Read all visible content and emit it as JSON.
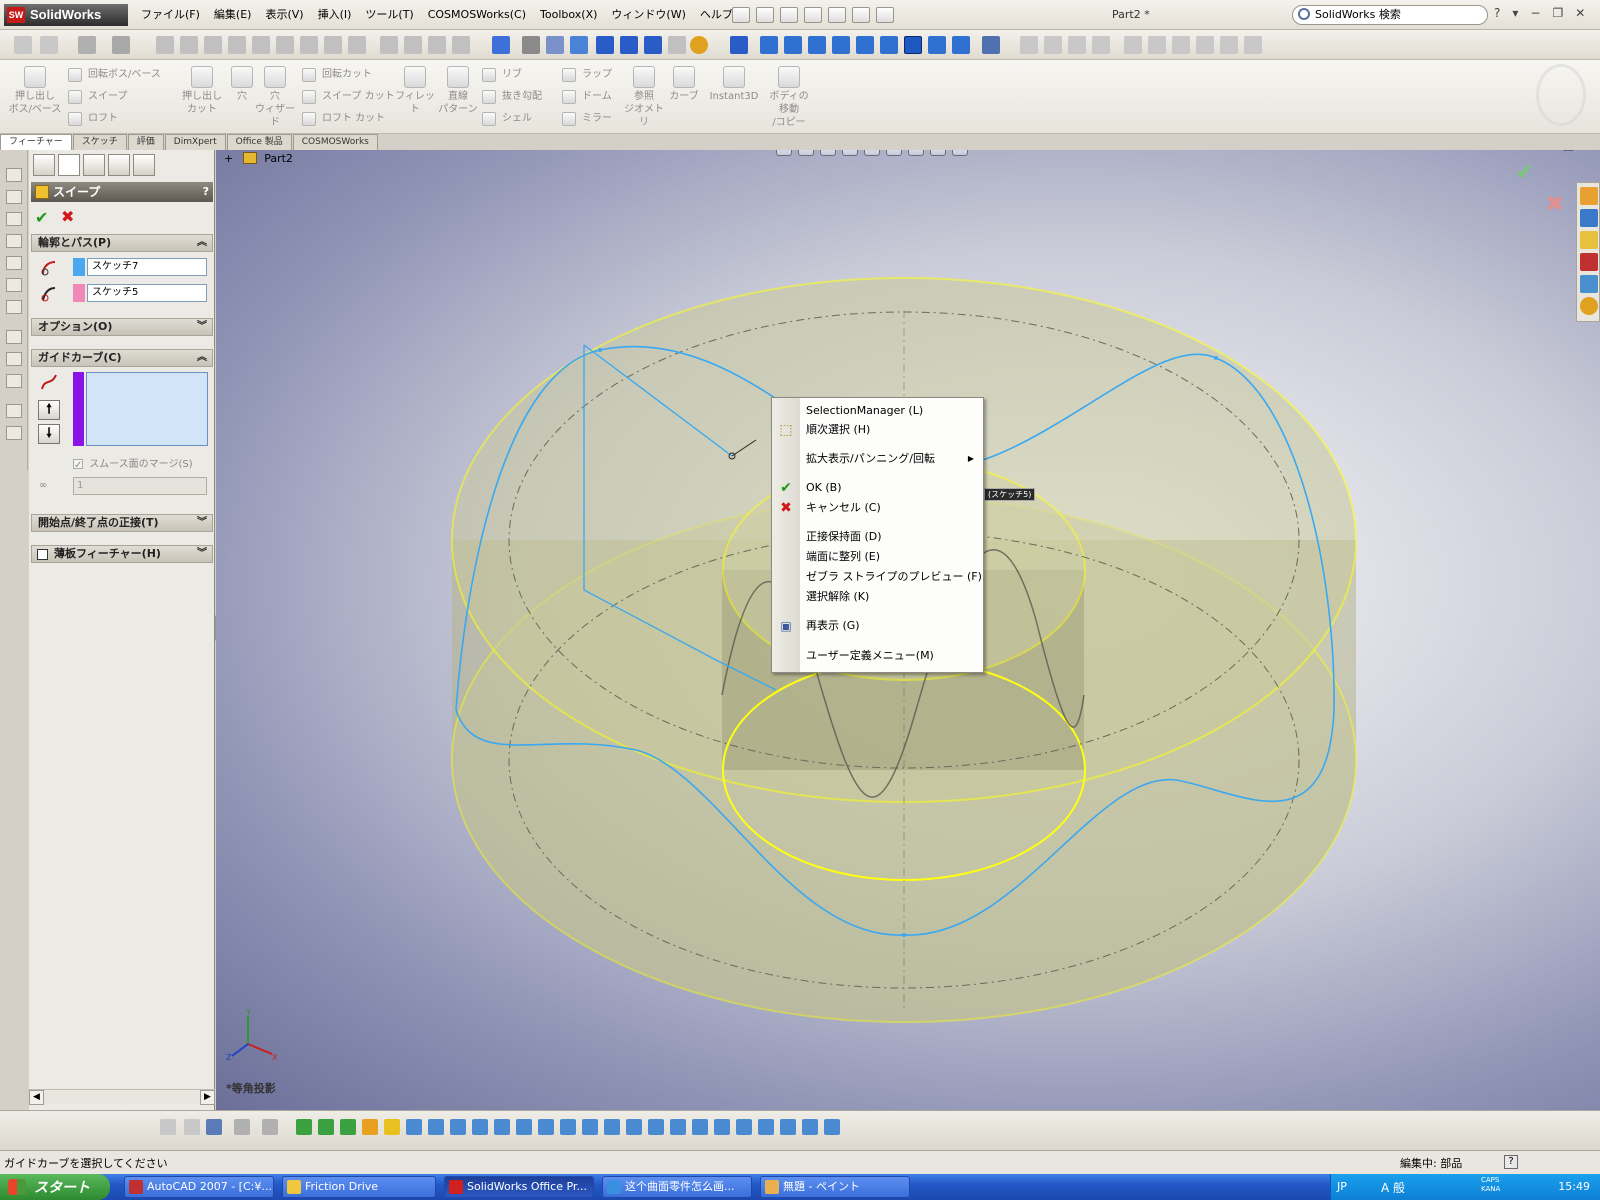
{
  "app": {
    "logo_text": "SolidWorks",
    "document_title": "Part2 *",
    "search_placeholder": "SolidWorks 検索",
    "window_controls": [
      "?",
      "▾",
      "−",
      "❐",
      "✕"
    ]
  },
  "menu": [
    "ファイル(F)",
    "編集(E)",
    "表示(V)",
    "挿入(I)",
    "ツール(T)",
    "COSMOSWorks(C)",
    "Toolbox(X)",
    "ウィンドウ(W)",
    "ヘルプ(H)"
  ],
  "command_manager": {
    "large": [
      {
        "label": "押し出し\nボス/ベース"
      },
      {
        "label": "押し出し\nカット"
      },
      {
        "label": "穴"
      },
      {
        "label": "穴\nウィザード"
      },
      {
        "label": "フィレット"
      },
      {
        "label": "直線\nパターン"
      },
      {
        "label": "参照\nジオメトリ"
      },
      {
        "label": "カーブ"
      },
      {
        "label": "Instant3D"
      },
      {
        "label": "ボディの\n移動\n/コピー"
      }
    ],
    "small": {
      "revolve_boss": "回転ボス/ベース",
      "sweep": "スイープ",
      "loft": "ロフト",
      "revolve_cut": "回転カット",
      "sweep_cut": "スイープ カット",
      "loft_cut": "ロフト カット",
      "rib": "リブ",
      "draft": "抜き勾配",
      "shell": "シェル",
      "wrap": "ラップ",
      "dome": "ドーム",
      "mirror": "ミラー"
    }
  },
  "tabs": [
    "フィーチャー",
    "スケッチ",
    "評価",
    "DimXpert",
    "Office 製品",
    "COSMOSWorks"
  ],
  "property_manager": {
    "title": "スイープ",
    "groups": {
      "profile_path": "輪郭とパス(P)",
      "options": "オプション(O)",
      "guide_curves": "ガイドカーブ(C)",
      "tangency": "開始点/終了点の正接(T)",
      "thin_feature": "薄板フィーチャー(H)"
    },
    "profile_field": "スケッチ7",
    "path_field": "スケッチ5",
    "merge_smooth_label": "スムース面のマージ(S)",
    "spin_value": "1",
    "colors": {
      "profile": "#4aa8f0",
      "path": "#f088b8",
      "guide": "#8a14e8"
    }
  },
  "viewport": {
    "tree_root": "Part2",
    "view_label": "*等角投影",
    "sketch_tag": "(スケッチ5)"
  },
  "context_menu": {
    "items": [
      {
        "label": "SelectionManager (L)"
      },
      {
        "label": "順次選択 (H)",
        "icon": "select-icon"
      },
      {
        "label": "拡大表示/パンニング/回転",
        "submenu": true
      },
      {
        "label": "OK (B)",
        "icon": "check-icon"
      },
      {
        "label": "キャンセル (C)",
        "icon": "cross-icon"
      },
      {
        "label": "正接保持面 (D)"
      },
      {
        "label": "端面に整列 (E)"
      },
      {
        "label": "ゼブラ ストライプのプレビュー (F)"
      },
      {
        "label": "選択解除 (K)"
      },
      {
        "label": "再表示 (G)",
        "icon": "redraw-icon"
      },
      {
        "label": "ユーザー定義メニュー(M)"
      }
    ]
  },
  "status_bar": {
    "message": "ガイドカーブを選択してください",
    "mode": "編集中: 部品",
    "help": "?"
  },
  "taskbar": {
    "start_label": "スタート",
    "tasks": [
      "AutoCAD 2007 - [C:¥...",
      "Friction Drive",
      "SolidWorks Office Pr...",
      "这个曲面零件怎么画...",
      "無題 - ペイント"
    ],
    "tray_lang": "JP",
    "tray_ime": "A 般",
    "tray_caps": "CAPS\nKANA",
    "clock": "15:49"
  }
}
